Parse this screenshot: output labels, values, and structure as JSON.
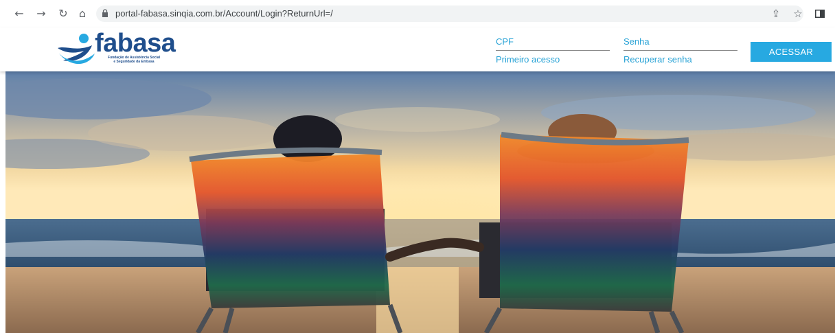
{
  "browser": {
    "url": "portal-fabasa.sinqia.com.br/Account/Login?ReturnUrl=/",
    "icons": [
      "back-arrow-icon",
      "forward-arrow-icon",
      "reload-icon",
      "home-icon",
      "lock-icon",
      "share-icon",
      "star-icon",
      "sidebar-icon"
    ]
  },
  "header": {
    "logo": {
      "name": "fabasa",
      "subtitle_line1": "Fundação de Assistência Social",
      "subtitle_line2": "e Seguridade da Embasa"
    },
    "login": {
      "cpf_placeholder": "CPF",
      "senha_placeholder": "Senha",
      "primeiro_acesso": "Primeiro acesso",
      "recuperar_senha": "Recuperar senha",
      "acessar_label": "ACESSAR"
    }
  },
  "colors": {
    "brand_blue": "#1f4e8c",
    "link_blue": "#29a3d6",
    "button_blue": "#27a9e1"
  }
}
